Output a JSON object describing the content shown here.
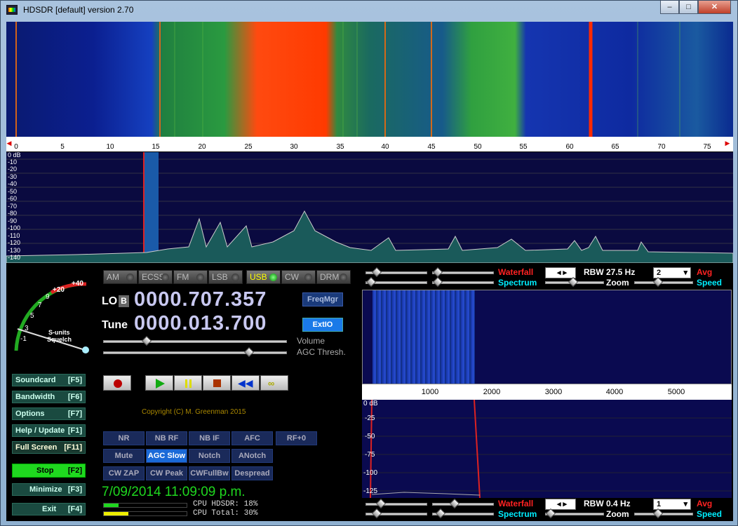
{
  "window": {
    "title": "HDSDR [default]  version 2.70",
    "minimize": "–",
    "maximize": "□",
    "close": "✕"
  },
  "main_scale": {
    "labels": [
      "0",
      "5",
      "10",
      "15",
      "20",
      "25",
      "30",
      "35",
      "40",
      "45",
      "50",
      "55",
      "60",
      "65",
      "70",
      "75"
    ]
  },
  "main_spectrum": {
    "db_labels": [
      "0 dB",
      "-10",
      "-20",
      "-30",
      "-40",
      "-50",
      "-60",
      "-70",
      "-80",
      "-90",
      "-100",
      "-110",
      "-120",
      "-130",
      "-140"
    ]
  },
  "modes": [
    {
      "label": "AM",
      "active": false
    },
    {
      "label": "ECSS",
      "active": false
    },
    {
      "label": "FM",
      "active": false
    },
    {
      "label": "LSB",
      "active": false
    },
    {
      "label": "USB",
      "active": true
    },
    {
      "label": "CW",
      "active": false
    },
    {
      "label": "DRM",
      "active": false
    }
  ],
  "smeter": {
    "label1": "S-units",
    "label2": "Squelch",
    "marks": [
      "-1",
      "3",
      "5",
      "7",
      "9",
      "+20",
      "+40"
    ]
  },
  "lo": {
    "label": "LO",
    "badge": "B",
    "value": "0000.707.357"
  },
  "tune": {
    "label": "Tune",
    "value": "0000.013.700"
  },
  "buttons": {
    "freqmgr": "FreqMgr",
    "extio": "ExtIO"
  },
  "sliders": {
    "volume": "Volume",
    "agc": "AGC Thresh."
  },
  "copyright": "Copyright (C) M. Greenman 2015",
  "sidebar": [
    {
      "label": "Soundcard",
      "key": "[F5]"
    },
    {
      "label": "Bandwidth",
      "key": "[F6]"
    },
    {
      "label": "Options",
      "key": "[F7]"
    },
    {
      "label": "Help / Update",
      "key": "[F1]"
    },
    {
      "label": "Full Screen",
      "key": "[F11]"
    },
    {
      "label": "Stop",
      "key": "[F2]"
    },
    {
      "label": "Minimize",
      "key": "[F3]"
    },
    {
      "label": "Exit",
      "key": "[F4]"
    }
  ],
  "dsp": {
    "row1": [
      "NR",
      "NB RF",
      "NB IF",
      "AFC"
    ],
    "rf0": "RF+0",
    "row2": [
      "Mute",
      "AGC Slow",
      "Notch",
      "ANotch"
    ],
    "row3": [
      "CW ZAP",
      "CW Peak",
      "CWFullBw",
      "Despread"
    ]
  },
  "clock": "7/09/2014 11:09:09 p.m.",
  "cpu": {
    "hdsdr": "CPU HDSDR: 18%",
    "total": "CPU Total: 30%",
    "hdsdr_pct": 18,
    "total_pct": 30
  },
  "top_ctl": {
    "waterfall": "Waterfall",
    "spectrum": "Spectrum",
    "rbw": "RBW 27.5 Hz",
    "zoom": "Zoom",
    "avg_val": "2",
    "avg": "Avg",
    "speed": "Speed"
  },
  "bot_ctl": {
    "waterfall": "Waterfall",
    "spectrum": "Spectrum",
    "rbw": "RBW  0.4 Hz",
    "zoom": "Zoom",
    "avg_val": "1",
    "avg": "Avg",
    "speed": "Speed"
  },
  "sub_scale": {
    "labels": [
      "1000",
      "2000",
      "3000",
      "4000",
      "5000"
    ]
  },
  "sub_spectrum": {
    "db_labels": [
      "0 dB",
      "-25",
      "-50",
      "-75",
      "-100",
      "-125"
    ]
  },
  "colors": {
    "accent": "#1fd81f",
    "waterfall_hot": "#ff3a00",
    "spectrum_bg": "#0a0a40"
  }
}
